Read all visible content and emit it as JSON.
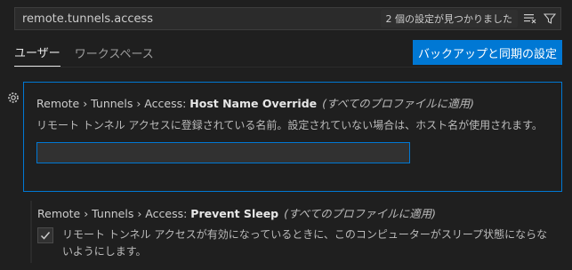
{
  "search": {
    "value": "remote.tunnels.access",
    "results_label": "2 個の設定が見つかりました"
  },
  "tabs": [
    {
      "label": "ユーザー",
      "active": true
    },
    {
      "label": "ワークスペース",
      "active": false
    }
  ],
  "backup_button_label": "バックアップと同期の設定",
  "settings": [
    {
      "category": "Remote › Tunnels › Access: ",
      "name": "Host Name Override",
      "scope": "(すべてのプロファイルに適用)",
      "description": "リモート トンネル アクセスに登録されている名前。設定されていない場合は、ホスト名が使用されます。",
      "input_value": ""
    },
    {
      "category": "Remote › Tunnels › Access: ",
      "name": "Prevent Sleep",
      "scope": "(すべてのプロファイルに適用)",
      "checkbox_label": "リモート トンネル アクセスが有効になっているときに、このコンピューターがスリープ状態にならないようにします。",
      "checked": true
    }
  ],
  "colors": {
    "accent": "#0078d4",
    "background": "#1f1f1f"
  },
  "icons": {
    "clear_filter": "clear-filter-icon",
    "filter": "filter-icon",
    "gear": "gear-icon",
    "check": "check-icon"
  }
}
